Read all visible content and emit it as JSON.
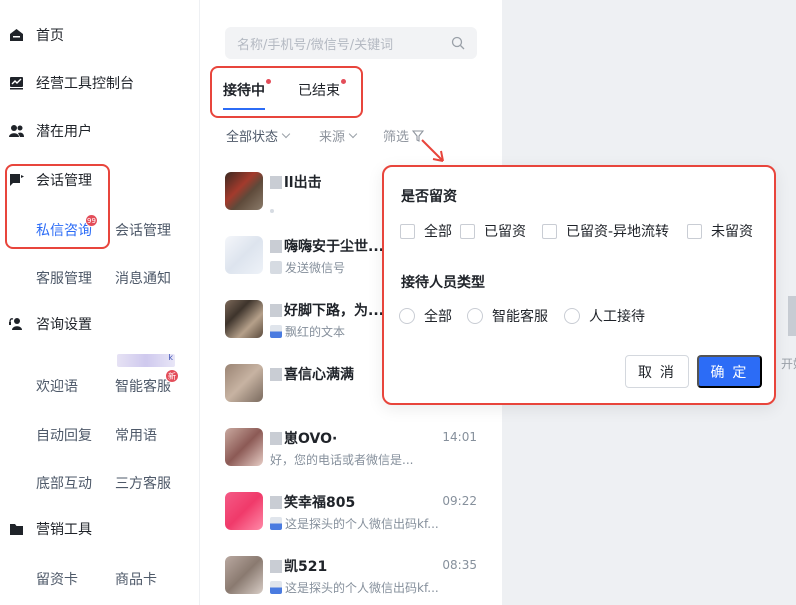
{
  "sidebar": {
    "home": "首页",
    "ops_console": "经营工具控制台",
    "potential_users": "潜在用户",
    "conversation_mgmt": {
      "label": "会话管理",
      "items": [
        "私信咨询",
        "会话管理",
        "客服管理",
        "消息通知"
      ],
      "dm_badge": "99"
    },
    "consult_settings": {
      "label": "咨询设置",
      "blur_tag_suffix": "k",
      "items": [
        "欢迎语",
        "智能客服",
        "自动回复",
        "常用语",
        "底部互动",
        "三方客服"
      ],
      "new_badge": "新"
    },
    "marketing_tools": {
      "label": "营销工具",
      "items": [
        "留资卡",
        "商品卡"
      ]
    }
  },
  "middle": {
    "search_placeholder": "名称/手机号/微信号/关键词",
    "tabs": [
      "接待中",
      "已结束"
    ],
    "filters": [
      "全部状态",
      "来源",
      "筛选"
    ],
    "conversations": [
      {
        "name": "ll出击",
        "preview": "",
        "time": ""
      },
      {
        "name": "嗨嗨安于尘世...",
        "preview": "发送微信号",
        "time": ""
      },
      {
        "name": "好脚下路，为...",
        "preview": "飘红的文本",
        "time": ""
      },
      {
        "name": "喜信心满满",
        "preview": "",
        "time": ""
      },
      {
        "name": "崽OVO·",
        "preview": "好，您的电话或者微信是...",
        "time": "14:01"
      },
      {
        "name": "笑幸福805",
        "preview": "这是探头的个人微信出码kf...",
        "time": "09:22"
      },
      {
        "name": "凯521",
        "preview": "这是探头的个人微信出码kf...",
        "time": "08:35"
      }
    ]
  },
  "right": {
    "hint": "开始"
  },
  "popup": {
    "section1_title": "是否留资",
    "checkboxes": [
      "全部",
      "已留资",
      "已留资-异地流转",
      "未留资"
    ],
    "section2_title": "接待人员类型",
    "radios": [
      "全部",
      "智能客服",
      "人工接待"
    ],
    "cancel": "取 消",
    "confirm": "确 定"
  },
  "colors": {
    "accent": "#2c6cf6",
    "highlight": "#e8453c",
    "badge": "#e34d59"
  }
}
